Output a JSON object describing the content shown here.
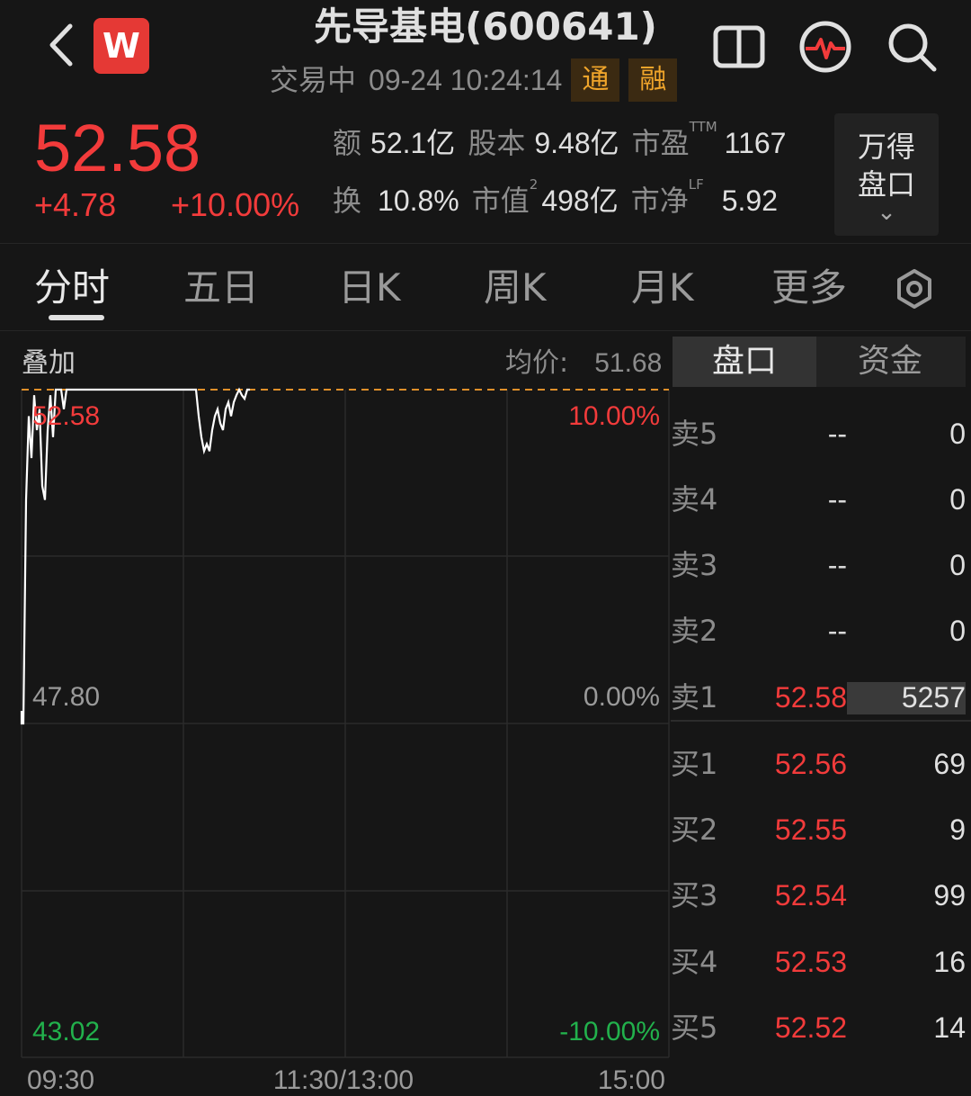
{
  "header": {
    "stock_title": "先导基电(600641)",
    "status": "交易中",
    "datetime": "09-24 10:24:14",
    "tags": [
      "通",
      "融"
    ],
    "logo_letter": "W",
    "icons": [
      "back-icon",
      "split-view-icon",
      "heartbeat-icon",
      "search-icon"
    ]
  },
  "quote": {
    "price": "52.58",
    "change": "+4.78",
    "change_pct": "+10.00%",
    "stats": {
      "amount_label": "额",
      "amount": "52.1亿",
      "share_capital_label": "股本",
      "share_capital": "9.48亿",
      "pe_label": "市盈",
      "pe_sup": "TTM",
      "pe": "1167",
      "turnover_label": "换",
      "turnover": "10.8%",
      "mcap_label": "市值",
      "mcap_sup": "2",
      "mcap": "498亿",
      "pb_label": "市净",
      "pb_sup": "LF",
      "pb": "5.92"
    },
    "wande_line1": "万得",
    "wande_line2": "盘口",
    "wande_chevron": "⌄"
  },
  "tabs": [
    "分时",
    "五日",
    "日K",
    "周K",
    "月K",
    "更多"
  ],
  "chart": {
    "overlay_label": "叠加",
    "avg_price_label": "均价:",
    "avg_price": "51.68",
    "y_left": [
      "52.58",
      "47.80",
      "43.02"
    ],
    "y_right": [
      "10.00%",
      "0.00%",
      "-10.00%"
    ],
    "x_labels": [
      "09:30",
      "11:30/13:00",
      "15:00"
    ],
    "colors": {
      "up": "#f23b3b",
      "down": "#22b14c",
      "line": "#ffffff",
      "limit_dash": "#e0902a"
    }
  },
  "chart_data": {
    "type": "line",
    "ylim": [
      43.02,
      52.58
    ],
    "pct_range": [
      "-10.00%",
      "10.00%"
    ],
    "series": [
      {
        "values": [
          47.8,
          51.0,
          52.2,
          51.6,
          52.5,
          52.0,
          52.3,
          51.2,
          51.0,
          52.0,
          52.5,
          51.9,
          52.58,
          52.58,
          52.58,
          52.3,
          52.58,
          52.58,
          52.58,
          52.58,
          52.58,
          52.58,
          52.58,
          52.58,
          52.58,
          52.58,
          52.58,
          52.58,
          52.58,
          52.58,
          52.58,
          52.58,
          52.58,
          52.58,
          52.58,
          52.58,
          52.58,
          52.58,
          52.58,
          52.58,
          52.58,
          52.58,
          52.58,
          52.58,
          52.58,
          52.58,
          52.58,
          52.58,
          52.58,
          52.58,
          52.58,
          52.58,
          52.58,
          52.58,
          52.58,
          52.58,
          52.58,
          52.58,
          52.58,
          52.58,
          52.58,
          52.58,
          52.58,
          52.58,
          52.58,
          52.2,
          51.9,
          51.7,
          51.8,
          51.7,
          52.0,
          52.2,
          52.3,
          52.1,
          52.0,
          52.3,
          52.4,
          52.2,
          52.4,
          52.5,
          52.58,
          52.5,
          52.45,
          52.58,
          52.58
        ]
      }
    ],
    "total_minutes": 240
  },
  "right_panel": {
    "tabs": [
      "盘口",
      "资金"
    ],
    "asks": [
      {
        "label": "卖5",
        "price": "--",
        "vol": "0"
      },
      {
        "label": "卖4",
        "price": "--",
        "vol": "0"
      },
      {
        "label": "卖3",
        "price": "--",
        "vol": "0"
      },
      {
        "label": "卖2",
        "price": "--",
        "vol": "0"
      },
      {
        "label": "卖1",
        "price": "52.58",
        "vol": "5257"
      }
    ],
    "bids": [
      {
        "label": "买1",
        "price": "52.56",
        "vol": "69"
      },
      {
        "label": "买2",
        "price": "52.55",
        "vol": "9"
      },
      {
        "label": "买3",
        "price": "52.54",
        "vol": "99"
      },
      {
        "label": "买4",
        "price": "52.53",
        "vol": "16"
      },
      {
        "label": "买5",
        "price": "52.52",
        "vol": "14"
      }
    ]
  }
}
